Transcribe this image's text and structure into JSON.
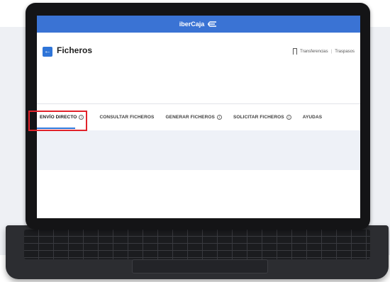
{
  "app": {
    "brand": "iberCaja",
    "brand_color": "#3a73d4"
  },
  "header": {
    "title": "Ficheros",
    "links": [
      "Transferencias",
      "Traspasos"
    ]
  },
  "tabs": [
    {
      "label": "ENVÍO DIRECTO",
      "info": true,
      "active": true
    },
    {
      "label": "CONSULTAR FICHEROS",
      "info": false,
      "active": false
    },
    {
      "label": "GENERAR FICHEROS",
      "info": true,
      "active": false
    },
    {
      "label": "SOLICITAR FICHEROS",
      "info": true,
      "active": false
    },
    {
      "label": "AYUDAS",
      "info": false,
      "active": false
    }
  ],
  "icons": {
    "back": "arrow-left-icon",
    "bookmark": "bookmark-icon",
    "info": "info-icon",
    "logo": "ibercaja-logo-icon"
  },
  "highlight_color": "#e1222a"
}
